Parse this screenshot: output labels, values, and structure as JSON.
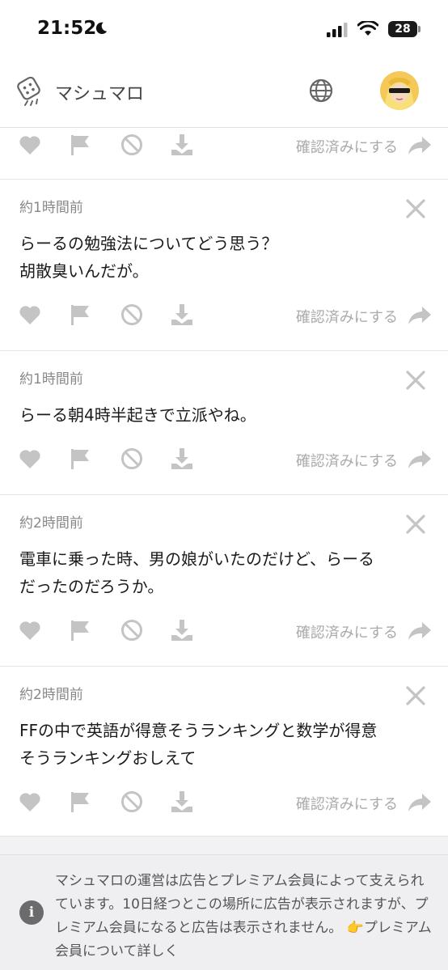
{
  "status": {
    "time": "21:52",
    "battery": "28"
  },
  "header": {
    "title": "マシュマロ"
  },
  "top_action_row": {
    "confirm_label": "確認済みにする"
  },
  "messages": [
    {
      "time": "約1時間前",
      "text": "らーるの勉強法についてどう思う？\n胡散臭いんだが。",
      "confirm_label": "確認済みにする"
    },
    {
      "time": "約1時間前",
      "text": "らーる朝4時半起きで立派やね。",
      "confirm_label": "確認済みにする"
    },
    {
      "time": "約2時間前",
      "text": "電車に乗った時、男の娘がいたのだけど、らーる\nだったのだろうか。",
      "confirm_label": "確認済みにする"
    },
    {
      "time": "約2時間前",
      "text": "FFの中で英語が得意そうランキングと数学が得意\nそうランキングおしえて",
      "confirm_label": "確認済みにする"
    }
  ],
  "notice": {
    "text": "マシュマロの運営は広告とプレミアム会員によって支えられています。10日経つとこの場所に広告が表示されますが、プレミアム会員になると広告は表示されません。",
    "link": "👉プレミアム会員について詳しく"
  },
  "colors": {
    "icon_gray": "#c4c4c4",
    "text_gray": "#888888",
    "accent_text": "#1b1b1b"
  },
  "icons": [
    "moon-icon",
    "signal-icon",
    "wifi-icon",
    "marshmallow-logo-icon",
    "globe-icon",
    "heart-icon",
    "flag-icon",
    "block-icon",
    "download-icon",
    "share-icon",
    "close-icon",
    "info-icon"
  ]
}
